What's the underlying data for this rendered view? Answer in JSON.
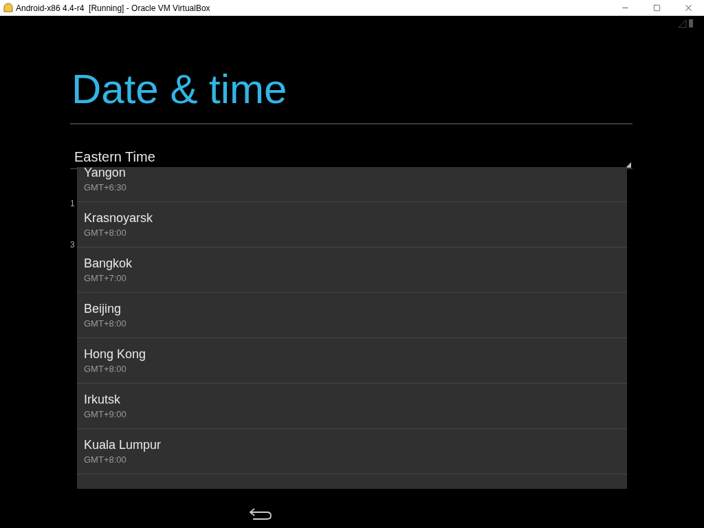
{
  "window": {
    "title": "Android-x86 4.4-r4  [Running] - Oracle VM VirtualBox"
  },
  "screen": {
    "title": "Date & time",
    "spinner": {
      "value": "Eastern Time",
      "expanded": true
    },
    "settings_behind": [
      {
        "summary": "1"
      },
      {
        "summary": "3"
      }
    ],
    "dropdown": [
      {
        "name": "Yangon",
        "offset": "GMT+6:30"
      },
      {
        "name": "Krasnoyarsk",
        "offset": "GMT+8:00"
      },
      {
        "name": "Bangkok",
        "offset": "GMT+7:00"
      },
      {
        "name": "Beijing",
        "offset": "GMT+8:00"
      },
      {
        "name": "Hong Kong",
        "offset": "GMT+8:00"
      },
      {
        "name": "Irkutsk",
        "offset": "GMT+9:00"
      },
      {
        "name": "Kuala Lumpur",
        "offset": "GMT+8:00"
      }
    ]
  }
}
